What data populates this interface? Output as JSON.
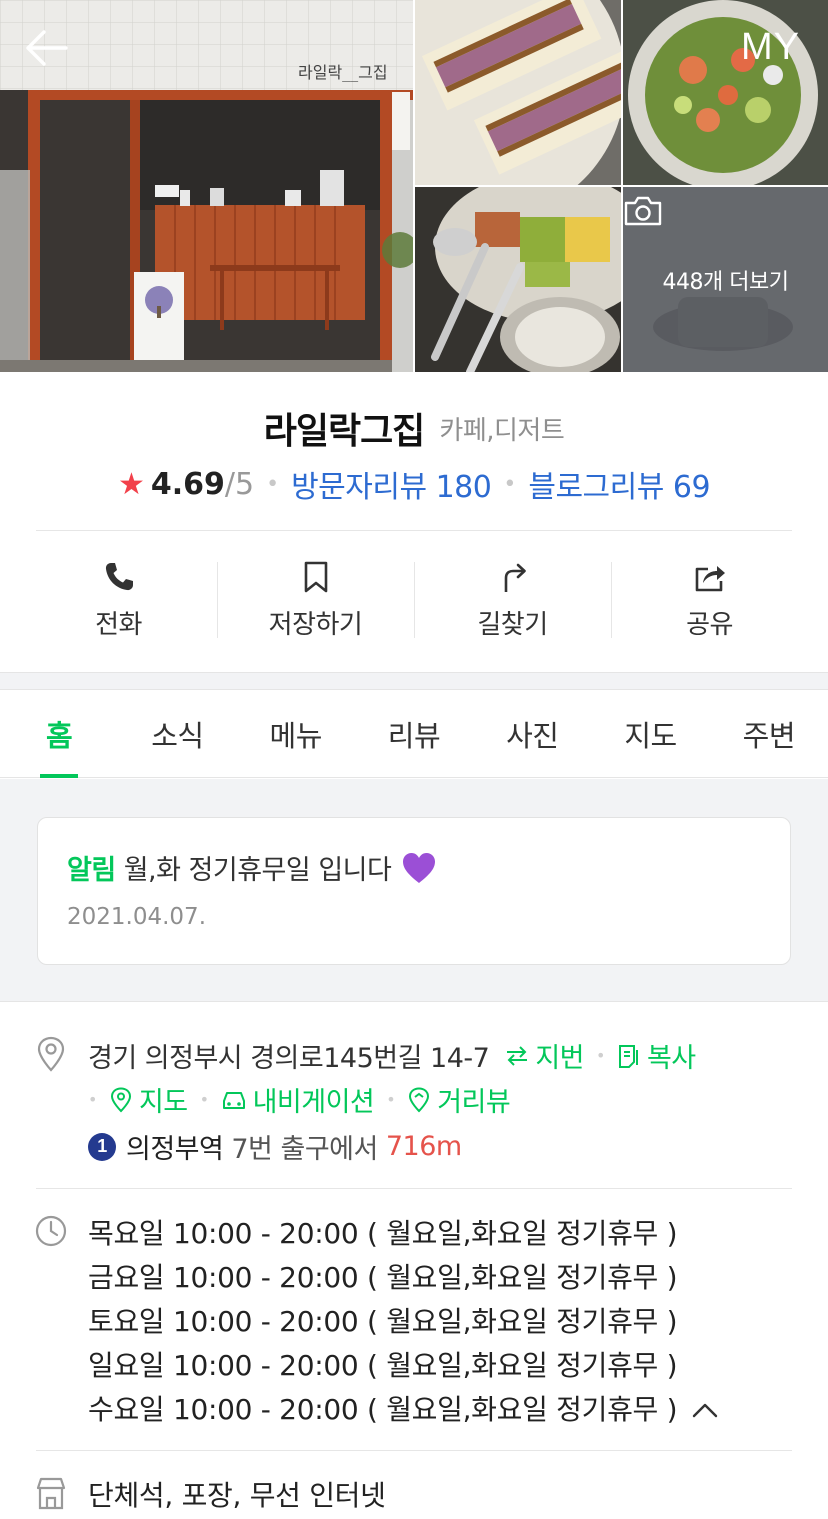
{
  "header": {
    "back_icon": "arrow-left-icon",
    "my_label": "MY"
  },
  "gallery": {
    "more_label": "448개 더보기",
    "camera_icon": "camera-icon",
    "storefront_sign": "라일락__그집"
  },
  "place": {
    "name": "라일락그집",
    "category": "카페,디저트",
    "rating": "4.69",
    "rating_max": "/5",
    "visitor_reviews": "방문자리뷰 180",
    "blog_reviews": "블로그리뷰 69"
  },
  "actions": [
    {
      "label": "전화",
      "icon": "phone-icon"
    },
    {
      "label": "저장하기",
      "icon": "bookmark-icon"
    },
    {
      "label": "길찾기",
      "icon": "directions-icon"
    },
    {
      "label": "공유",
      "icon": "share-icon"
    }
  ],
  "tabs": [
    {
      "label": "홈",
      "active": true
    },
    {
      "label": "소식"
    },
    {
      "label": "메뉴"
    },
    {
      "label": "리뷰"
    },
    {
      "label": "사진"
    },
    {
      "label": "지도"
    },
    {
      "label": "주변"
    }
  ],
  "notice": {
    "tag": "알림",
    "text": "월,화 정기휴무일 입니다",
    "date": "2021.04.07."
  },
  "address": {
    "text": "경기 의정부시 경의로145번길 14-7",
    "jibun_label": "지번",
    "copy_label": "복사",
    "map_label": "지도",
    "navigation_label": "내비게이션",
    "streetview_label": "거리뷰"
  },
  "subway": {
    "line": "1",
    "station": "의정부역",
    "exit": "7번 출구에서",
    "distance": "716m"
  },
  "hours": [
    "목요일 10:00 - 20:00 ( 월요일,화요일 정기휴무 )",
    "금요일 10:00 - 20:00 ( 월요일,화요일 정기휴무 )",
    "토요일 10:00 - 20:00 ( 월요일,화요일 정기휴무 )",
    "일요일 10:00 - 20:00 ( 월요일,화요일 정기휴무 )",
    "수요일 10:00 - 20:00 ( 월요일,화요일 정기휴무 )"
  ],
  "facilities": "단체석, 포장, 무선 인터넷",
  "colors": {
    "accent_green": "#03c75a",
    "link_blue": "#2d6bd1",
    "star_red": "#f2404a",
    "distance_red": "#e5534b",
    "subway_line1": "#243a8f"
  }
}
